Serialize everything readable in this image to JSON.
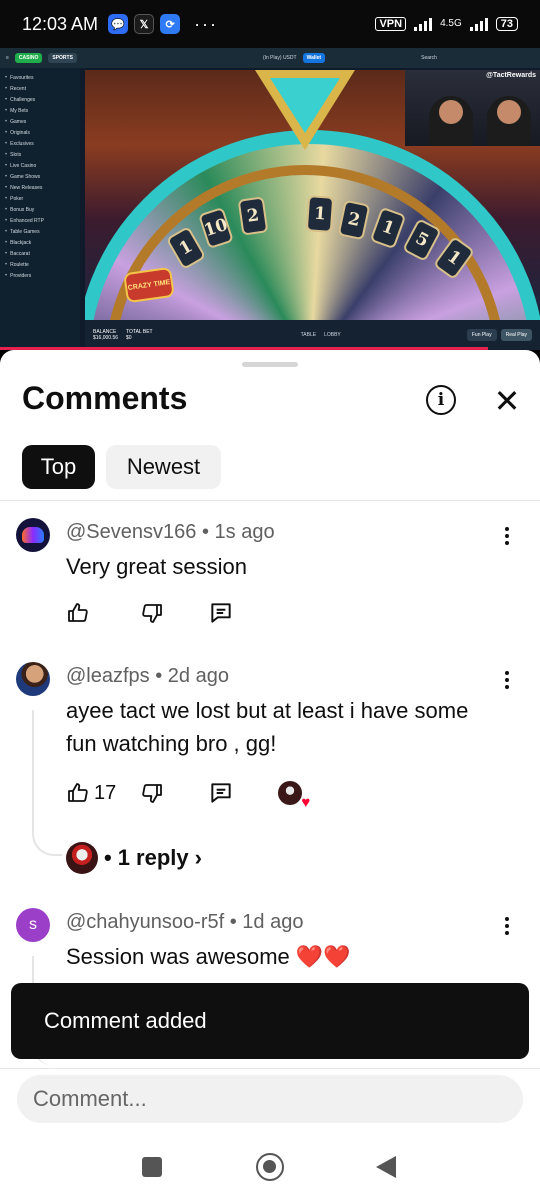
{
  "status_bar": {
    "time": "12:03 AM",
    "vpn": "VPN",
    "network": "4.5G",
    "battery": "73"
  },
  "video": {
    "site_tabs": [
      "CASINO",
      "SPORTS"
    ],
    "play_mode": "(In Play) USDT",
    "wallet": "Wallet",
    "search": "Search",
    "sidebar_items": [
      "Favourites",
      "Recent",
      "Challenges",
      "My Bets",
      "Games",
      "Originals",
      "Exclusives",
      "Slots",
      "Live Casino",
      "Game Shows",
      "New Releases",
      "Poker",
      "Bonus Buy",
      "Enhanced RTP",
      "Table Games",
      "Blackjack",
      "Baccarat",
      "Roulette",
      "Providers"
    ],
    "webcam_tag": "@TactRewards",
    "wheel_numbers": [
      "1",
      "10",
      "2",
      "1",
      "2",
      "1",
      "5",
      "1"
    ],
    "logo_text": "CRAZY TIME",
    "balance_label": "BALANCE",
    "balance_value": "$16,000.56",
    "total_bet_label": "TOTAL BET",
    "total_bet_value": "$0",
    "table_label": "TABLE",
    "lobby_label": "LOBBY",
    "fun_play": "Fun Play",
    "real_play": "Real Play"
  },
  "panel": {
    "title": "Comments",
    "info_icon": "info-icon",
    "close_icon": "close-icon",
    "sort_tabs": [
      "Top",
      "Newest"
    ],
    "selected_sort": "Top"
  },
  "comments": [
    {
      "author": "@Sevensv166",
      "age": "1s ago",
      "text": "Very great session",
      "likes": ""
    },
    {
      "author": "@leazfps",
      "age": "2d ago",
      "text": "ayee tact we lost but at least i have some fun watching bro , gg!",
      "likes": "17",
      "replies": "1 reply"
    },
    {
      "author": "@chahyunsoo-r5f",
      "avatar_letter": "s",
      "age": "1d ago",
      "text": "Session was awesome ❤️❤️"
    }
  ],
  "toast": {
    "message": "Comment added"
  },
  "composer": {
    "placeholder": "Comment..."
  },
  "colors": {
    "accent_dark": "#0f0f0f",
    "chip_bg": "#f1f1f1",
    "meta_text": "#606060",
    "progress_red": "#e5224f",
    "avatar_purple": "#9c3fc8"
  }
}
